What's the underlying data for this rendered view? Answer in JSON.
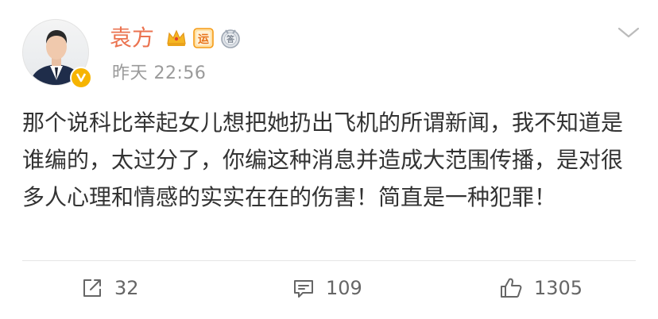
{
  "post": {
    "author": "袁方",
    "timestamp": "昨天 22:56",
    "text": "那个说科比举起女儿想把她扔出飞机的所谓新闻，我不知道是谁编的，太过分了，你编这种消息并造成大范围传播，是对很多人心理和情感的实实在在的伤害！简直是一种犯罪！",
    "badges": [
      {
        "icon": "crown-badge-icon",
        "color": "#f3a712"
      },
      {
        "icon": "yun-badge-icon",
        "label": "运",
        "color": "#f59b16"
      },
      {
        "icon": "medal-badge-icon",
        "label": "答",
        "color": "#9ea7b3"
      }
    ],
    "verified_color": "#f6b400"
  },
  "actions": {
    "repost_count": "32",
    "comment_count": "109",
    "like_count": "1305"
  },
  "colors": {
    "author": "#eb7350",
    "text": "#333333",
    "meta": "#9a9a9a"
  }
}
